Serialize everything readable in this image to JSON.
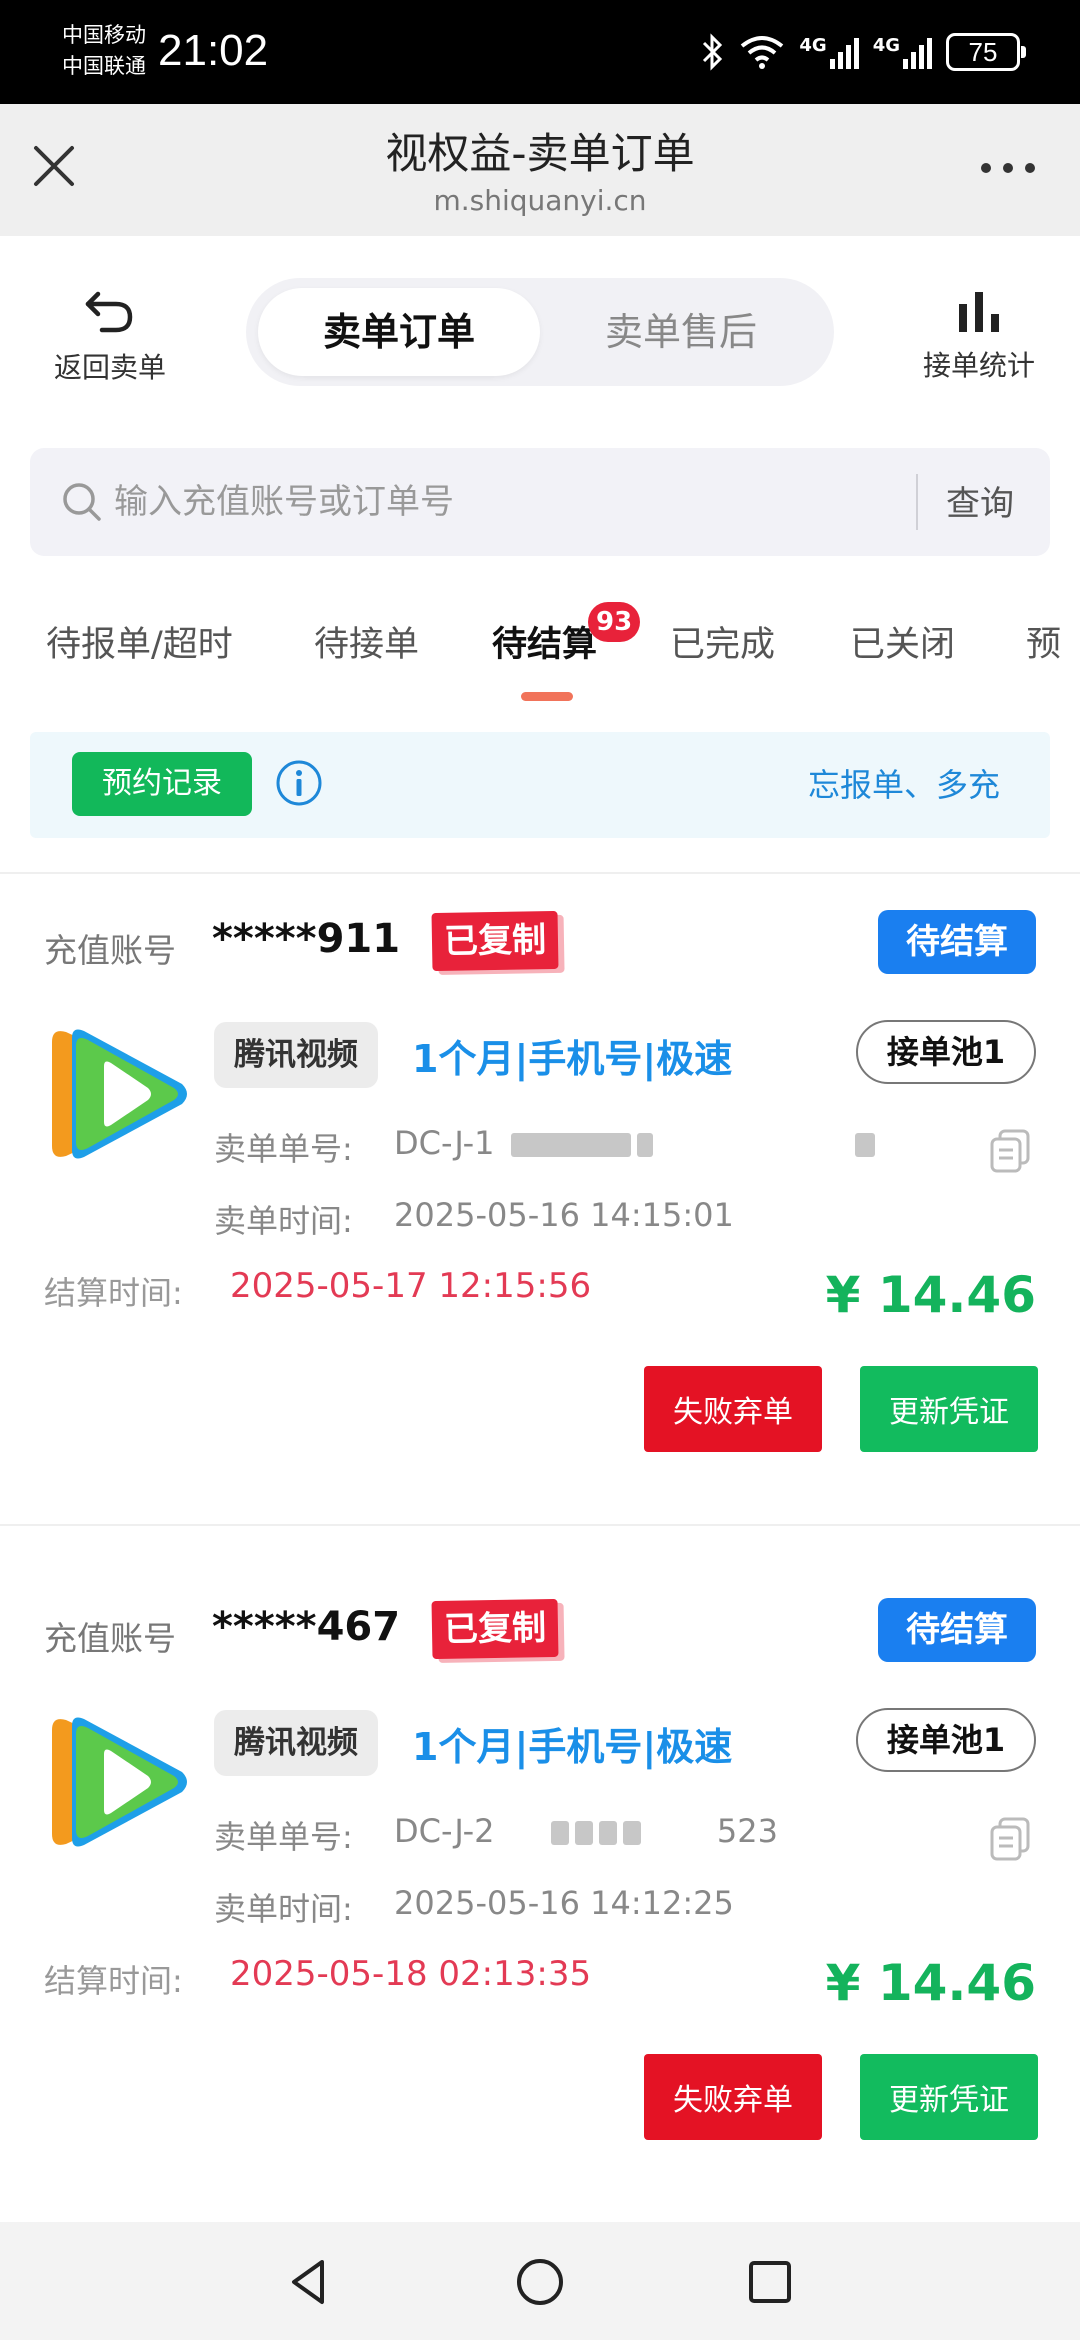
{
  "status_bar": {
    "carrier1": "中国移动",
    "carrier2": "中国联通",
    "time": "21:02",
    "network1": "4G",
    "network2": "4G",
    "battery": "75"
  },
  "browser": {
    "title": "视权益-卖单订单",
    "url": "m.shiquanyi.cn"
  },
  "nav": {
    "back_label": "返回卖单",
    "segment_active": "卖单订单",
    "segment_inactive": "卖单售后",
    "stats_label": "接单统计"
  },
  "search": {
    "placeholder": "输入充值账号或订单号",
    "button": "查询"
  },
  "tabs": [
    {
      "label": "待报单/超时"
    },
    {
      "label": "待接单"
    },
    {
      "label": "待结算",
      "badge": "93"
    },
    {
      "label": "已完成"
    },
    {
      "label": "已关闭"
    },
    {
      "label": "预"
    }
  ],
  "notice": {
    "button": "预约记录",
    "text": "忘报单、多充"
  },
  "orders": [
    {
      "account_label": "充值账号",
      "account": "*****911",
      "copied_tag": "已复制",
      "status": "待结算",
      "platform": "腾讯视频",
      "product": "1个月|手机号|极速",
      "pool": "接单池1",
      "order_no_label": "卖单单号:",
      "order_no": "DC-J-1",
      "order_no_tail": "",
      "order_time_label": "卖单时间:",
      "order_time": "2025-05-16 14:15:01",
      "settle_label": "结算时间:",
      "settle_time": "2025-05-17 12:15:56",
      "price": "¥ 14.46",
      "fail_button": "失败弃单",
      "update_button": "更新凭证"
    },
    {
      "account_label": "充值账号",
      "account": "*****467",
      "copied_tag": "已复制",
      "status": "待结算",
      "platform": "腾讯视频",
      "product": "1个月|手机号|极速",
      "pool": "接单池1",
      "order_no_label": "卖单单号:",
      "order_no": "DC-J-2",
      "order_no_tail": "523",
      "order_time_label": "卖单时间:",
      "order_time": "2025-05-16 14:12:25",
      "settle_label": "结算时间:",
      "settle_time": "2025-05-18 02:13:35",
      "price": "¥ 14.46",
      "fail_button": "失败弃单",
      "update_button": "更新凭证"
    }
  ],
  "icons": {
    "close": "close-icon",
    "more": "more-dots-icon",
    "back": "undo-arrow-icon",
    "stats": "bar-chart-icon",
    "search": "search-icon",
    "info": "info-icon",
    "copy": "copy-icon",
    "app_logo": "tencent-video-logo-icon"
  },
  "colors": {
    "green": "#12bb5e",
    "red": "#e41224",
    "blue": "#1a7ff0",
    "orange_indicator": "#f1735a"
  }
}
